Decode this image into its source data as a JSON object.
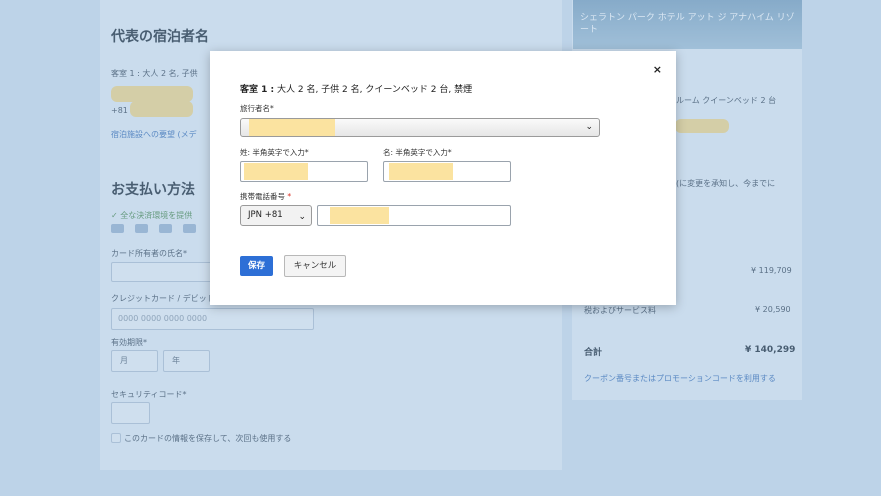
{
  "background": {
    "section_guest_title": "代表の宿泊者名",
    "room_summary": "客室 1 : 大人 2 名, 子供",
    "guest_prefix": "+81",
    "request_link": "宿泊施設への要望 (メデ",
    "section_payment_title": "お支払い方法",
    "payment_note": "✓ 全な決済環境を提供",
    "cardholder_label": "カード所有者の氏名*",
    "card_number_label": "クレジットカード / デビット",
    "card_number_placeholder": "0000 0000 0000 0000",
    "expiry_label": "有効期限*",
    "month_placeholder": "月",
    "year_placeholder": "年",
    "security_label": "セキュリティコード*",
    "save_card_text": "このカードの情報を保存して、次回も使用する",
    "hotel_name": "シェラトン パーク ホテル アット ジ アナハイム リゾート",
    "room_desc": "ルーム クイーンベッド 2 台",
    "cancel_note": "(に変更を承知し、今までに",
    "price_rows": [
      {
        "label": "",
        "value": "¥ 119,709"
      },
      {
        "label": "税およびサービス料",
        "value": "¥ 20,590"
      },
      {
        "label": "合計",
        "value": "¥ 140,299"
      }
    ],
    "coupon_link": "クーポン番号またはプロモーションコードを利用する"
  },
  "modal": {
    "close_label": "×",
    "room_label": "客室 1 :",
    "room_detail": "大人 2 名, 子供 2 名, クイーンベッド 2 台, 禁煙",
    "traveler_label": "旅行者名",
    "last_name_label": "姓: 半角英字で入力",
    "first_name_label": "名: 半角英字で入力",
    "phone_label": "携帯電話番号",
    "required_mark": "*",
    "country_code": "JPN +81",
    "save_label": "保存",
    "cancel_label": "キャンセル"
  }
}
